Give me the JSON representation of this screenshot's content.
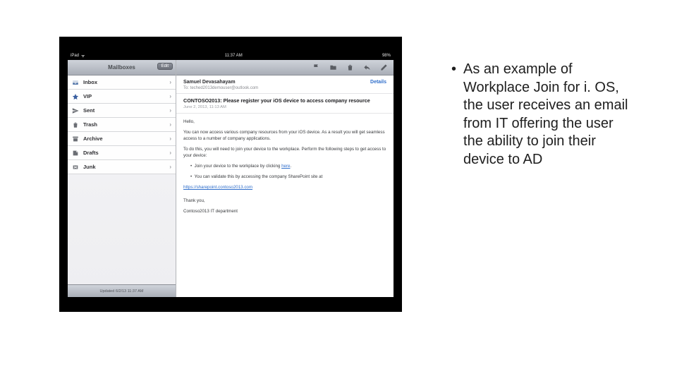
{
  "slide": {
    "bullet_text": "As an example of Workplace Join for i. OS, the user receives an email from IT offering the user the ability to join their device to AD"
  },
  "device": {
    "status": {
      "left": "iPad",
      "wifi": "᯾",
      "time": "11:37 AM",
      "battery": "98%"
    },
    "sidebar": {
      "title": "Mailboxes",
      "edit": "Edit",
      "items": [
        {
          "label": "Inbox",
          "icon": "inbox"
        },
        {
          "label": "VIP",
          "icon": "star"
        },
        {
          "label": "Sent",
          "icon": "sent"
        },
        {
          "label": "Trash",
          "icon": "trash"
        },
        {
          "label": "Archive",
          "icon": "archive"
        },
        {
          "label": "Drafts",
          "icon": "drafts"
        },
        {
          "label": "Junk",
          "icon": "junk"
        }
      ],
      "footer": "Updated 6/2/13 11:37 AM"
    },
    "toolbar_icons": [
      "flag",
      "folder",
      "trash",
      "reply",
      "compose"
    ],
    "message": {
      "from": "Samuel Devasahayam",
      "to": "To: teched2013demouser@outlook.com",
      "details": "Details",
      "subject": "CONTOSO2013: Please register your iOS device to access company resource",
      "date": "June 2, 2013, 11:13 AM",
      "greeting": "Hello,",
      "para1": "You can now access various company resources from your iOS device. As a result you will get seamless access to a number of company applications.",
      "para2": "To do this, you will need to join your device to the workplace. Perform the following steps to get access to your device:",
      "step1_pre": "Join your device to the workplace by clicking ",
      "step1_link": "here",
      "step2_pre": "You can validate this by accessing the company SharePoint site at",
      "step2_link": "https://sharepoint.contoso2013.com",
      "signoff1": "Thank you,",
      "signoff2": "Contoso2013 IT department"
    }
  }
}
